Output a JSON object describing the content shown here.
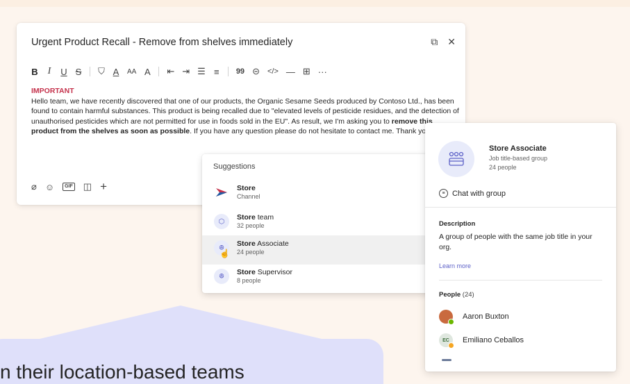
{
  "compose": {
    "subject": "Urgent Product Recall - Remove from shelves immediately",
    "popout_icon": "popout-icon",
    "close_icon": "close-icon",
    "toolbar": {
      "bold": "B",
      "italic": "I",
      "underline": "U",
      "strike": "S",
      "highlight": "⛉",
      "font_color": "A",
      "font_size": "AA",
      "format": "A",
      "outdent": "⇤",
      "indent": "⇥",
      "bullets": "☰",
      "numbered": "≡",
      "quote": "99",
      "link": "⊝",
      "code": "</>",
      "hr": "—",
      "table": "⊞",
      "more": "···"
    },
    "body": {
      "important": "IMPORTANT",
      "p1": "Hello team, we have recently discovered that one of our products, the Organic Sesame Seeds produced by Contoso Ltd., has been found to contain harmful substances. This product is being recalled due to \"elevated levels of pesticide residues, and the detection of unauthorised pesticides which are not permitted for use in foods sold in the EU\". As result, we I'm asking you to ",
      "bold": "remove this product from the shelves as soon as possible",
      "p2": ". If you have any question please do not hesitate to contact me. Thank you! @Store"
    },
    "actions": {
      "attach": "⌀",
      "emoji": "☺",
      "gif": "GIF",
      "sticker": "◫",
      "plus": "+"
    }
  },
  "suggestions": {
    "header": "Suggestions",
    "items": [
      {
        "bold": "Store",
        "rest": "",
        "sub": "Channel"
      },
      {
        "bold": "Store",
        "rest": " team",
        "sub": "32 people"
      },
      {
        "bold": "Store",
        "rest": " Associate",
        "sub": "24 people"
      },
      {
        "bold": "Store",
        "rest": " Supervisor",
        "sub": "8 people"
      }
    ]
  },
  "profile": {
    "name": "Store Associate",
    "type": "Job title-based group",
    "count": "24 people",
    "chat": "Chat with group",
    "desc_label": "Description",
    "desc": "A group of people with the same job title in your org.",
    "learn_more": "Learn more",
    "people_label": "People",
    "people_count": " (24)",
    "people": [
      {
        "name": "Aaron Buxton",
        "initials": "",
        "status": "available"
      },
      {
        "name": "Emiliano Ceballos",
        "initials": "EC",
        "status": "away"
      }
    ]
  },
  "callout": {
    "text": "n their location-based teams"
  },
  "colors": {
    "accent": "#5b5fc7",
    "important": "#c4314b",
    "callout": "#dfe0fa",
    "background": "#fdf5ee"
  }
}
